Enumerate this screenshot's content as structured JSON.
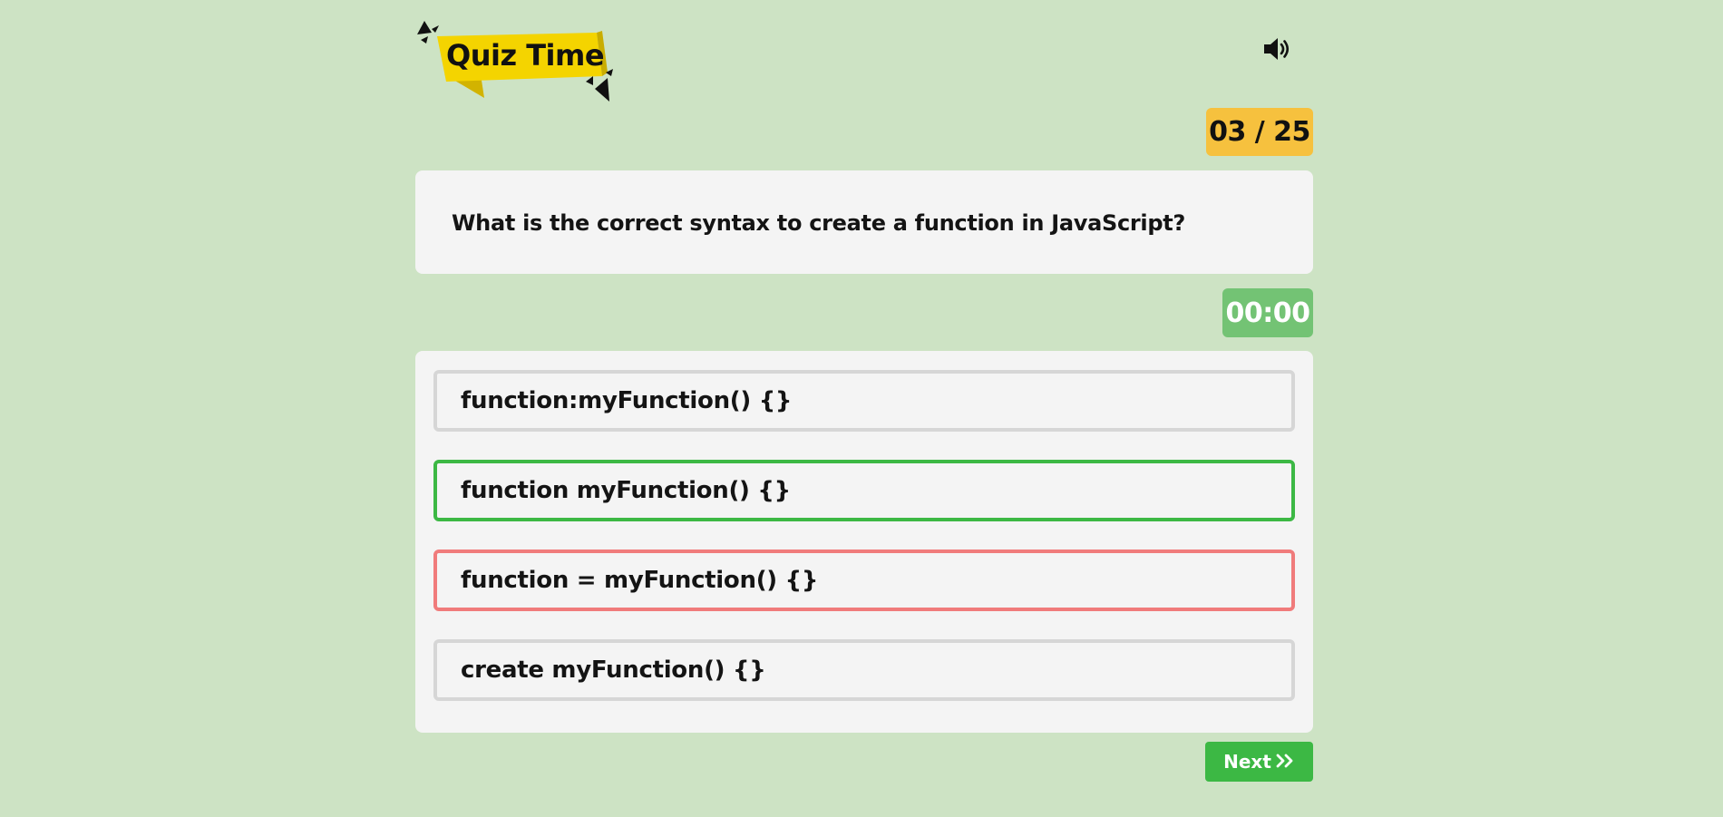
{
  "header": {
    "logo_text": "Quiz Time",
    "sound_icon": "speaker-volume-icon"
  },
  "quiz": {
    "counter": "03 / 25",
    "question": "What is the correct syntax to create a function in JavaScript?",
    "timer": "00:00",
    "options": [
      {
        "label": "function:myFunction() {}",
        "state": "default"
      },
      {
        "label": "function myFunction() {}",
        "state": "correct"
      },
      {
        "label": "function = myFunction() {}",
        "state": "wrong"
      },
      {
        "label": "create myFunction() {}",
        "state": "default"
      }
    ],
    "next_label": "Next",
    "next_icon": "double-chevron-right-icon"
  },
  "colors": {
    "background": "#cde3c4",
    "logo_banner": "#f4d400",
    "counter_badge": "#f6c13e",
    "card": "#f4f4f4",
    "timer_badge": "#73c374",
    "correct": "#3cb844",
    "wrong": "#f07b7b",
    "neutral_border": "#d6d6d6",
    "next_button": "#3cb844"
  }
}
